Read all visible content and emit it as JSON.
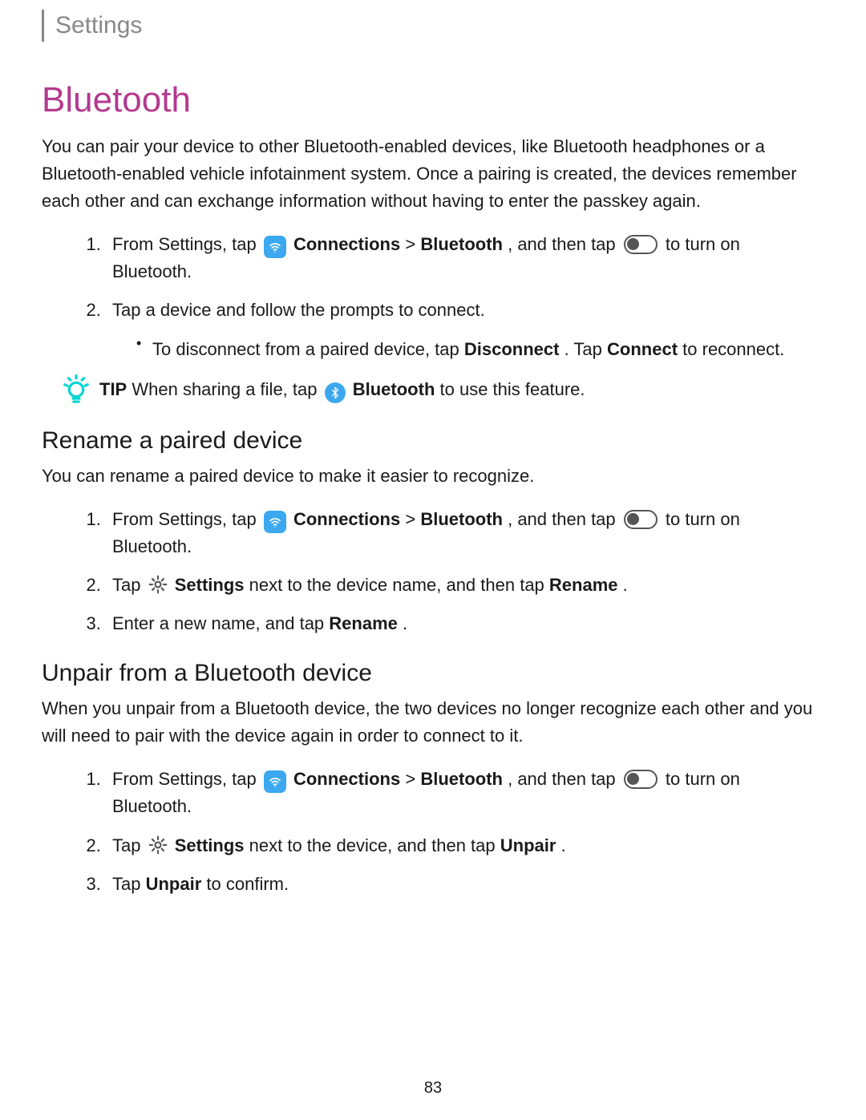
{
  "header": {
    "breadcrumb": "Settings"
  },
  "page_number": "83",
  "title": "Bluetooth",
  "intro": "You can pair your device to other Bluetooth-enabled devices, like Bluetooth headphones or a Bluetooth-enabled vehicle infotainment system. Once a pairing is created, the devices remember each other and can exchange information without having to enter the passkey again.",
  "icons": {
    "wifi_name": "wifi-icon",
    "bt_name": "bluetooth-icon",
    "toggle_name": "toggle-off-icon",
    "gear_name": "gear-icon",
    "tip_name": "lightbulb-icon"
  },
  "steps_a": {
    "s1": {
      "prefix": "From Settings, tap ",
      "connections": "Connections",
      "sep": " > ",
      "bluetooth": "Bluetooth",
      "mid": ", and then tap ",
      "suffix": " to turn on Bluetooth."
    },
    "s2": "Tap a device and follow the prompts to connect.",
    "s2_sub": {
      "prefix": "To disconnect from a paired device, tap ",
      "disconnect": "Disconnect",
      "mid": ". Tap ",
      "connect": "Connect",
      "suffix": " to reconnect."
    }
  },
  "tip": {
    "label": "TIP",
    "prefix": "  When sharing a file, tap ",
    "bluetooth": "Bluetooth",
    "suffix": " to use this feature."
  },
  "rename": {
    "heading": "Rename a paired device",
    "intro": "You can rename a paired device to make it easier to recognize.",
    "s2": {
      "prefix": "Tap ",
      "settings": "Settings",
      "mid": " next to the device name, and then tap ",
      "rename": "Rename",
      "suffix": "."
    },
    "s3": {
      "prefix": "Enter a new name, and tap ",
      "rename": "Rename",
      "suffix": "."
    }
  },
  "unpair": {
    "heading": "Unpair from a Bluetooth device",
    "intro": "When you unpair from a Bluetooth device, the two devices no longer recognize each other and you will need to pair with the device again in order to connect to it.",
    "s2": {
      "prefix": "Tap ",
      "settings": "Settings",
      "mid": " next to the device, and then tap ",
      "unpair": "Unpair",
      "suffix": "."
    },
    "s3": {
      "prefix": "Tap ",
      "unpair": "Unpair",
      "suffix": " to confirm."
    }
  }
}
